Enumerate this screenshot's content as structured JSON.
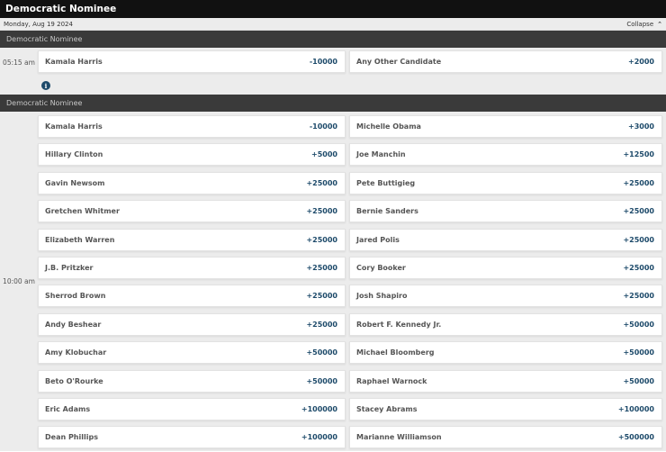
{
  "header": {
    "title": "Democratic Nominee"
  },
  "date_bar": {
    "date": "Monday, Aug 19 2024",
    "collapse_label": "Collapse",
    "collapse_icon": "chevron-up-icon"
  },
  "colors": {
    "topbar": "#111111",
    "section_header": "#3a3a3a",
    "odds": "#1d4a6a",
    "info_icon": "#1d4a6a"
  },
  "sections": [
    {
      "title": "Democratic Nominee",
      "time": "05:15 am",
      "selections": [
        {
          "name": "Kamala Harris",
          "odds": "-10000"
        },
        {
          "name": "Any Other Candidate",
          "odds": "+2000"
        }
      ]
    },
    {
      "title": "Democratic Nominee",
      "time": "10:00 am",
      "selections": [
        {
          "name": "Kamala Harris",
          "odds": "-10000"
        },
        {
          "name": "Michelle Obama",
          "odds": "+3000"
        },
        {
          "name": "Hillary Clinton",
          "odds": "+5000"
        },
        {
          "name": "Joe Manchin",
          "odds": "+12500"
        },
        {
          "name": "Gavin Newsom",
          "odds": "+25000"
        },
        {
          "name": "Pete Buttigieg",
          "odds": "+25000"
        },
        {
          "name": "Gretchen Whitmer",
          "odds": "+25000"
        },
        {
          "name": "Bernie Sanders",
          "odds": "+25000"
        },
        {
          "name": "Elizabeth Warren",
          "odds": "+25000"
        },
        {
          "name": "Jared Polis",
          "odds": "+25000"
        },
        {
          "name": "J.B. Pritzker",
          "odds": "+25000"
        },
        {
          "name": "Cory Booker",
          "odds": "+25000"
        },
        {
          "name": "Sherrod Brown",
          "odds": "+25000"
        },
        {
          "name": "Josh Shapiro",
          "odds": "+25000"
        },
        {
          "name": "Andy Beshear",
          "odds": "+25000"
        },
        {
          "name": "Robert F. Kennedy Jr.",
          "odds": "+50000"
        },
        {
          "name": "Amy Klobuchar",
          "odds": "+50000"
        },
        {
          "name": "Michael Bloomberg",
          "odds": "+50000"
        },
        {
          "name": "Beto O'Rourke",
          "odds": "+50000"
        },
        {
          "name": "Raphael Warnock",
          "odds": "+50000"
        },
        {
          "name": "Eric Adams",
          "odds": "+100000"
        },
        {
          "name": "Stacey Abrams",
          "odds": "+100000"
        },
        {
          "name": "Dean Phillips",
          "odds": "+100000"
        },
        {
          "name": "Marianne Williamson",
          "odds": "+500000"
        }
      ]
    }
  ]
}
